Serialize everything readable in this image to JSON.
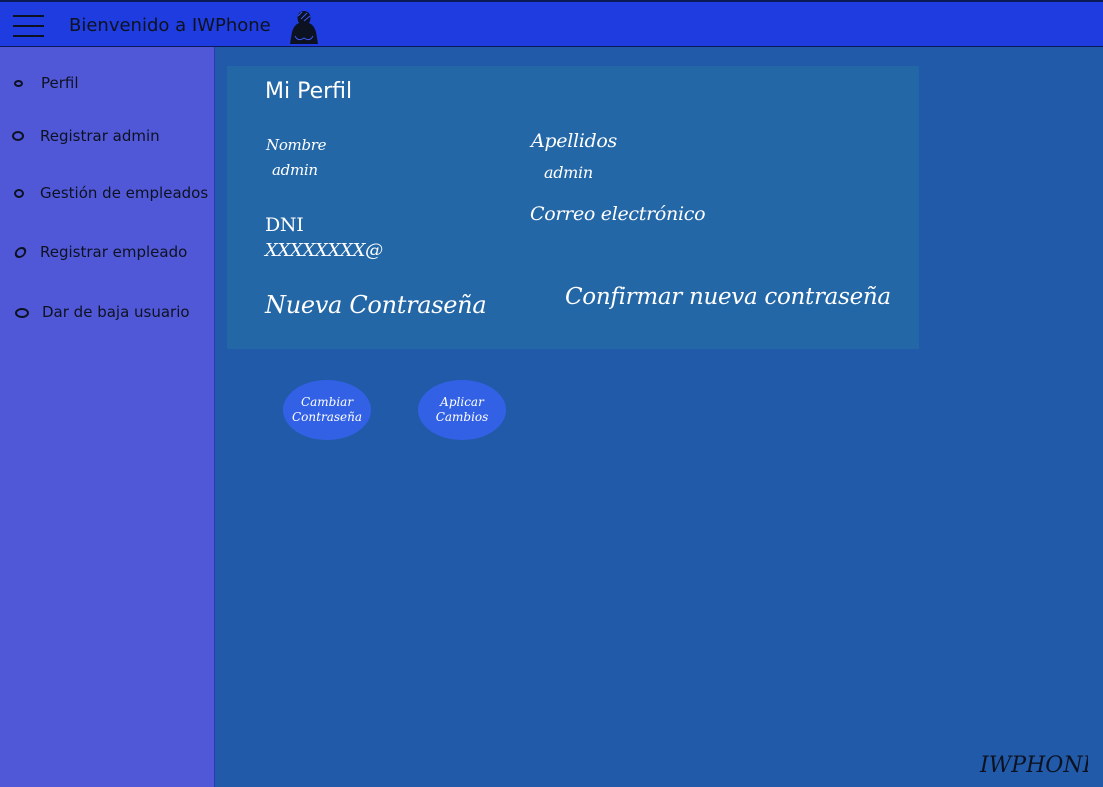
{
  "header": {
    "title": "Bienvenido a IWPhone",
    "menu_icon": "hamburger-menu-icon",
    "logo_icon": "iwphone-logo-icon"
  },
  "sidebar": {
    "items": [
      {
        "label": "Perfil"
      },
      {
        "label": "Registrar admin"
      },
      {
        "label": "Gestión de empleados"
      },
      {
        "label": "Registrar empleado"
      },
      {
        "label": "Dar de baja usuario"
      }
    ]
  },
  "profile": {
    "title": "Mi Perfil",
    "name_label": "Nombre",
    "name_value": "admin",
    "surname_label": "Apellidos",
    "surname_value": "admin",
    "dni_label": "DNI",
    "dni_value": "XXXXXXXX@",
    "email_label": "Correo electrónico",
    "new_password_label": "Nueva Contraseña",
    "confirm_password_label": "Confirmar nueva contraseña"
  },
  "actions": {
    "change_password_line1": "Cambiar",
    "change_password_line2": "Contraseña",
    "apply_changes_line1": "Aplicar",
    "apply_changes_line2": "Cambios"
  },
  "footer": {
    "brand": "IWPHONE"
  },
  "colors": {
    "page_bg": "#215aa9",
    "topbar": "#1e3ce0",
    "sidebar": "#5058d8",
    "card": "#2467a7",
    "button": "#3361e6"
  }
}
